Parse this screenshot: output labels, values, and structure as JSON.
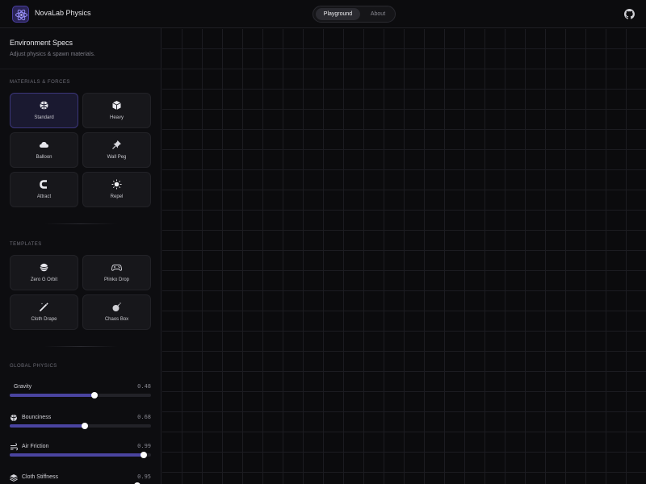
{
  "header": {
    "app_title": "NovaLab Physics",
    "tabs": [
      {
        "label": "Playground",
        "active": true
      },
      {
        "label": "About",
        "active": false
      }
    ],
    "github_icon": "github-icon"
  },
  "sidebar": {
    "title": "Environment Specs",
    "subtitle": "Adjust physics & spawn materials.",
    "materials_label": "MATERIALS & FORCES",
    "materials": [
      {
        "label": "Standard",
        "icon": "ball-icon",
        "selected": true
      },
      {
        "label": "Heavy",
        "icon": "cube-icon",
        "selected": false
      },
      {
        "label": "Balloon",
        "icon": "cloud-icon",
        "selected": false
      },
      {
        "label": "Wall Peg",
        "icon": "pin-icon",
        "selected": false
      },
      {
        "label": "Attract",
        "icon": "magnet-icon",
        "selected": false
      },
      {
        "label": "Repel",
        "icon": "burst-icon",
        "selected": false
      }
    ],
    "templates_label": "TEMPLATES",
    "templates": [
      {
        "label": "Zero G Orbit",
        "icon": "planet-icon"
      },
      {
        "label": "Plinko Drop",
        "icon": "gamepad-icon"
      },
      {
        "label": "Cloth Drape",
        "icon": "wand-icon"
      },
      {
        "label": "Chaos Box",
        "icon": "bomb-icon"
      }
    ],
    "physics_label": "GLOBAL PHYSICS",
    "sliders": [
      {
        "label": "Gravity",
        "value": "0.48",
        "fraction": 0.6,
        "icon": ""
      },
      {
        "label": "Bounciness",
        "value": "0.68",
        "fraction": 0.53,
        "icon": "bounce-icon"
      },
      {
        "label": "Air Friction",
        "value": "0.99",
        "fraction": 0.95,
        "icon": "wind-icon"
      },
      {
        "label": "Cloth Stiffness",
        "value": "0.95",
        "fraction": 0.9,
        "icon": "layers-icon"
      }
    ]
  },
  "colors": {
    "accent": "#4a44a0",
    "background": "#0b0b0d",
    "selected_card": "#1a1930"
  }
}
